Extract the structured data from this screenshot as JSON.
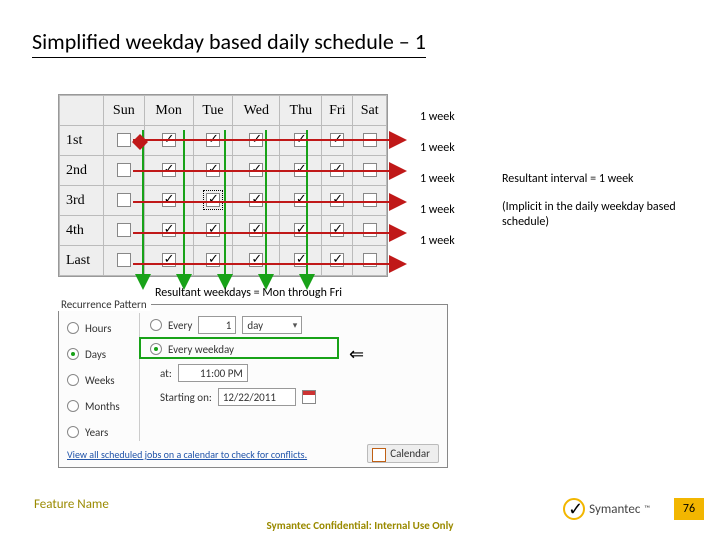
{
  "title": "Simplified weekday based daily schedule – 1",
  "grid": {
    "days": [
      "Sun",
      "Mon",
      "Tue",
      "Wed",
      "Thu",
      "Fri",
      "Sat"
    ],
    "rows": [
      "1st",
      "2nd",
      "3rd",
      "4th",
      "Last"
    ],
    "checked_columns": [
      1,
      2,
      3,
      4,
      5
    ],
    "focus_cell": {
      "row": 2,
      "col": 2
    }
  },
  "weeks_labels": [
    "1 week",
    "1 week",
    "1 week",
    "1 week",
    "1 week"
  ],
  "explain": {
    "line1": "Resultant interval = 1 week",
    "line2": "(Implicit in the daily weekday based schedule)"
  },
  "mid_caption": "Resultant weekdays = Mon through Fri",
  "recurrence": {
    "header": "Recurrence Pattern",
    "radios": [
      {
        "label": "Hours",
        "on": false
      },
      {
        "label": "Days",
        "on": true
      },
      {
        "label": "Weeks",
        "on": false
      },
      {
        "label": "Months",
        "on": false
      },
      {
        "label": "Years",
        "on": false
      }
    ],
    "every_label": "Every",
    "every_value": "1",
    "every_unit": "day",
    "every_weekday_label": "Every weekday",
    "every_weekday_on": true,
    "every_n_on": false,
    "at_label": "at:",
    "at_value": "11:00 PM",
    "starting_label": "Starting on:",
    "starting_value": "12/22/2011",
    "view_link": "View all scheduled jobs on a calendar to check for conflicts.",
    "calendar_btn": "Calendar"
  },
  "footer": {
    "feature": "Feature Name",
    "confidential": "Symantec Confidential: Internal Use Only",
    "brand": "Symantec",
    "page": "76"
  }
}
